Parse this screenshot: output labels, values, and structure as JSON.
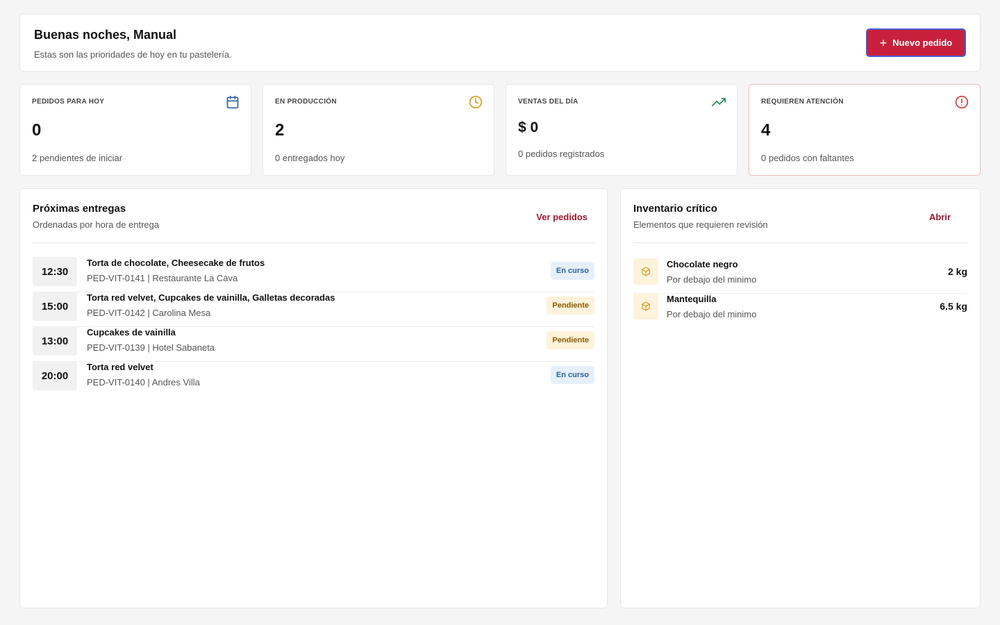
{
  "header": {
    "greeting": "Buenas noches, Manual",
    "subtitle": "Estas son las prioridades de hoy en tu pastelería.",
    "new_order_label": "Nuevo pedido"
  },
  "stats": [
    {
      "label": "PEDIDOS PARA HOY",
      "value": "0",
      "desc": "2 pendientes de iniciar",
      "icon": "calendar-icon",
      "color": "#2a5f9e"
    },
    {
      "label": "EN PRODUCCIÓN",
      "value": "2",
      "desc": "0 entregados hoy",
      "icon": "clock-icon",
      "color": "#d99a1c"
    },
    {
      "label": "VENTAS DEL DÍA",
      "value": "$ 0",
      "desc": "0 pedidos registrados",
      "icon": "trending-up-icon",
      "color": "#2e8b57"
    },
    {
      "label": "REQUIEREN ATENCIÓN",
      "value": "4",
      "desc": "0 pedidos con faltantes",
      "icon": "alert-circle-icon",
      "color": "#d23b3b"
    }
  ],
  "deliveries": {
    "title": "Próximas entregas",
    "subtitle": "Ordenadas por hora de entrega",
    "link": "Ver pedidos",
    "rows": [
      {
        "time": "12:30",
        "title": "Torta de chocolate, Cheesecake de frutos",
        "meta": "PED-VIT-0141  |  Restaurante La Cava",
        "status": "En curso"
      },
      {
        "time": "15:00",
        "title": "Torta red velvet, Cupcakes de vainilla, Galletas decoradas",
        "meta": "PED-VIT-0142  |  Carolina Mesa",
        "status": "Pendiente"
      },
      {
        "time": "13:00",
        "title": "Cupcakes de vainilla",
        "meta": "PED-VIT-0139  |  Hotel Sabaneta",
        "status": "Pendiente"
      },
      {
        "time": "20:00",
        "title": "Torta red velvet",
        "meta": "PED-VIT-0140  |  Andres Villa",
        "status": "En curso"
      }
    ]
  },
  "inventory": {
    "title": "Inventario crítico",
    "subtitle": "Elementos que requieren revisión",
    "link": "Abrir",
    "items": [
      {
        "name": "Chocolate negro",
        "note": "Por debajo del minimo",
        "qty": "2 kg",
        "icon": "box-icon"
      },
      {
        "name": "Mantequilla",
        "note": "Por debajo del minimo",
        "qty": "6.5 kg",
        "icon": "box-icon"
      }
    ]
  },
  "colors": {
    "accent": "#c8203c",
    "link": "#a0162b",
    "badge_progress_bg": "#e6f0fa",
    "badge_pending_bg": "#fdf3dc"
  }
}
